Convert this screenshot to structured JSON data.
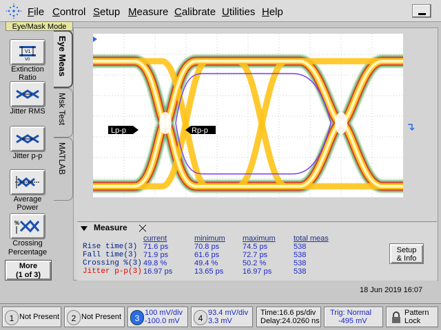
{
  "menu": [
    "File",
    "Control",
    "Setup",
    "Measure",
    "Calibrate",
    "Utilities",
    "Help"
  ],
  "menu_underline": [
    "F",
    "C",
    "S",
    "M",
    "C",
    "U",
    "H"
  ],
  "menu_rest": [
    "ile",
    "ontrol",
    "etup",
    "easure",
    "alibrate",
    "tilities",
    "elp"
  ],
  "mode": "Eye/Mask Mode",
  "sidebar": {
    "buttons": [
      {
        "label1": "Extinction",
        "label2": "Ratio",
        "icon": "extinction-ratio-icon"
      },
      {
        "label1": "Jitter RMS",
        "label2": "",
        "icon": "jitter-rms-icon"
      },
      {
        "label1": "Jitter p-p",
        "label2": "",
        "icon": "jitter-pp-icon"
      },
      {
        "label1": "Average",
        "label2": "Power",
        "icon": "average-power-icon"
      },
      {
        "label1": "Crossing",
        "label2": "Percentage",
        "icon": "crossing-percentage-icon"
      }
    ],
    "more": "More",
    "more_sub": "(1 of 3)"
  },
  "tabs": [
    "Eye Meas",
    "Msk Test",
    "MATLAB"
  ],
  "markers": {
    "left": "Lp-p",
    "right": "Rp-p"
  },
  "meas": {
    "title": "Measure",
    "headers": [
      "current",
      "minimum",
      "maximum",
      "total meas"
    ],
    "rows": [
      {
        "name": "Rise time(3)",
        "current": "71.6 ps",
        "minimum": "70.8 ps",
        "maximum": "74.5 ps",
        "total": "538"
      },
      {
        "name": "Fall time(3)",
        "current": "71.9 ps",
        "minimum": "61.6 ps",
        "maximum": "72.7 ps",
        "total": "538"
      },
      {
        "name": "Crossing %(3)",
        "current": "49.8 %",
        "minimum": "49.4 %",
        "maximum": "50.2 %",
        "total": "538"
      },
      {
        "name": "Jitter p-p(3)",
        "current": "16.97 ps",
        "minimum": "13.65 ps",
        "maximum": "16.97 ps",
        "total": "538"
      }
    ],
    "setup_label1": "Setup",
    "setup_label2": "& Info"
  },
  "datetime": "18 Jun 2019  16:07",
  "status": {
    "ch1": {
      "num": "1",
      "label": "Not Present"
    },
    "ch2": {
      "num": "2",
      "label": "Not Present"
    },
    "ch3": {
      "num": "3",
      "line1": "100 mV/div",
      "line2": "-100.0 mV"
    },
    "ch4": {
      "num": "4",
      "line1": "93.4 mV/div",
      "line2": "3.3 mV"
    },
    "time": {
      "line1": "Time:16.6 ps/div",
      "line2": "Delay:24.0260 ns"
    },
    "trig": {
      "line1": "Trig: Normal",
      "line2": "-495 mV"
    },
    "pattern": {
      "line1": "Pattern",
      "line2": "Lock"
    }
  },
  "colors": {
    "accent": "#2b6be6",
    "jitter": "#e00000"
  }
}
